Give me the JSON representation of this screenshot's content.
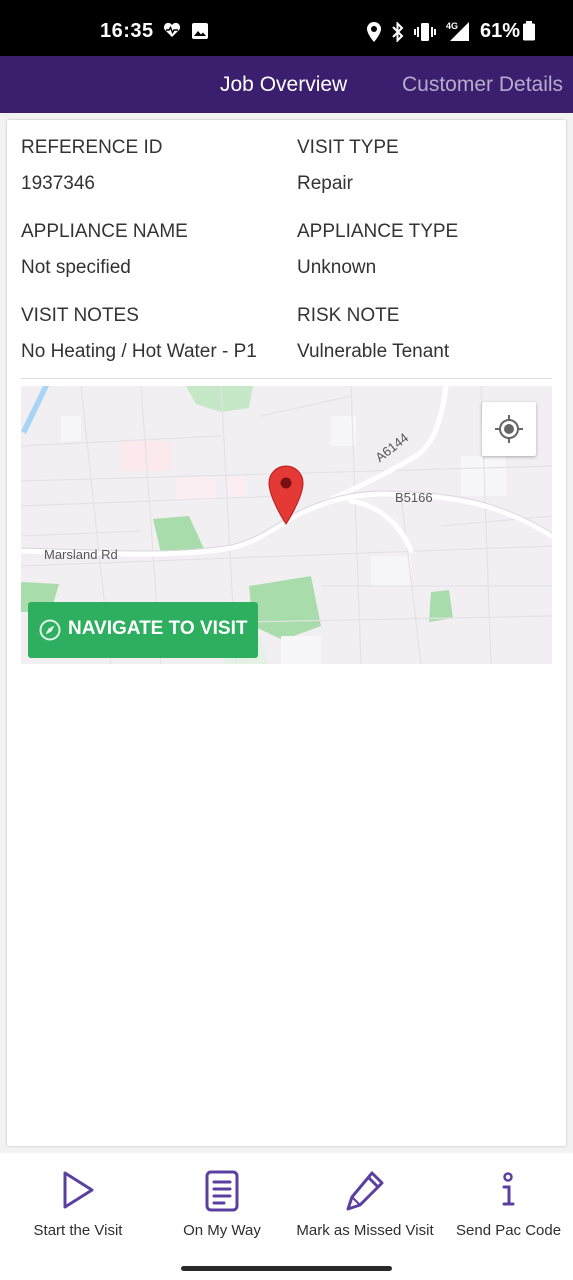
{
  "status_bar": {
    "time": "16:35",
    "battery_percent": "61%",
    "network": "4G",
    "icons": [
      "health-icon",
      "image-icon",
      "location-icon",
      "bluetooth-icon",
      "vibrate-icon",
      "signal-icon",
      "battery-icon"
    ]
  },
  "tabs": [
    {
      "label": "Job Overview",
      "active": true
    },
    {
      "label": "Customer Details",
      "active": false
    }
  ],
  "details": {
    "reference_id": {
      "label": "REFERENCE ID",
      "value": "1937346"
    },
    "visit_type": {
      "label": "VISIT TYPE",
      "value": "Repair"
    },
    "appliance_name": {
      "label": "APPLIANCE NAME",
      "value": "Not specified"
    },
    "appliance_type": {
      "label": "APPLIANCE TYPE",
      "value": "Unknown"
    },
    "visit_notes": {
      "label": "VISIT NOTES",
      "value": "No Heating / Hot Water - P1"
    },
    "risk_note": {
      "label": "RISK NOTE",
      "value": "Vulnerable Tenant"
    }
  },
  "map": {
    "road_labels": {
      "a6144": "A6144",
      "b5166": "B5166",
      "marsland": "Marsland Rd"
    },
    "navigate_label": "NAVIGATE TO VISIT",
    "marker_icon": "map-pin-icon",
    "locate_icon": "my-location-icon"
  },
  "actions": [
    {
      "label": "Start the Visit",
      "icon": "play-icon"
    },
    {
      "label": "On My Way",
      "icon": "document-icon"
    },
    {
      "label": "Mark as Missed Visit",
      "icon": "pen-icon"
    },
    {
      "label": "Send Pac Code",
      "icon": "info-icon"
    }
  ],
  "colors": {
    "header_purple": "#3b1f6e",
    "icon_purple": "#5b3fa0",
    "navigate_green": "#2eae5f",
    "marker_red": "#e53935"
  }
}
